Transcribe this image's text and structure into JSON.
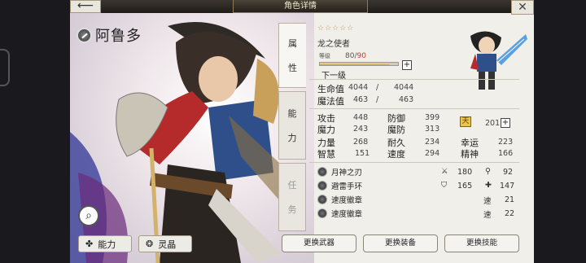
{
  "window": {
    "title": "角色详情",
    "back_label": "⟵",
    "close_label": "✕"
  },
  "character": {
    "name": "阿鲁多",
    "stars": "☆☆☆☆☆",
    "class": "龙之使者",
    "level_label": "等级",
    "level_current": "80",
    "level_sep": "/",
    "level_max": "90",
    "level_progress": 0.89,
    "next_label": "下一级"
  },
  "tabs": [
    {
      "label": "属",
      "label2": "性"
    },
    {
      "label": "能",
      "label2": "力"
    },
    {
      "label": "任",
      "label2": "务"
    }
  ],
  "vitals": {
    "hp_label": "生命值",
    "hp_cur": "4044",
    "hp_max": "4044",
    "mp_label": "魔法值",
    "mp_cur": "463",
    "mp_max": "463",
    "sep": "/"
  },
  "stats": {
    "atk_label": "攻击",
    "atk": "448",
    "def_label": "防御",
    "def": "399",
    "mag_label": "魔力",
    "mag": "243",
    "mdef_label": "魔防",
    "mdef": "313",
    "str_label": "力量",
    "str": "268",
    "end_label": "耐久",
    "end": "234",
    "luk_label": "幸运",
    "luk": "223",
    "int_label": "智慧",
    "int": "151",
    "spd_label": "速度",
    "spd": "294",
    "spi_label": "精神",
    "spi": "166",
    "gem_icon": "天",
    "gem_value": "201"
  },
  "equipment": [
    {
      "name": "月神之刃",
      "stat1": "180",
      "stat2": "92"
    },
    {
      "name": "避雷手环",
      "stat1": "165",
      "stat2": "147"
    },
    {
      "name": "速度徽章",
      "stat_label": "速",
      "stat": "21"
    },
    {
      "name": "速度徽章",
      "stat_label": "速",
      "stat": "22"
    }
  ],
  "bottom": {
    "ability_label": "能力",
    "spirit_label": "灵晶"
  },
  "actions": {
    "weapon": "更换武器",
    "gear": "更换装备",
    "skill": "更换技能"
  },
  "colors": {
    "accent": "#b89a5a",
    "panel": "#f1efe9",
    "frame": "#1f1c18"
  }
}
